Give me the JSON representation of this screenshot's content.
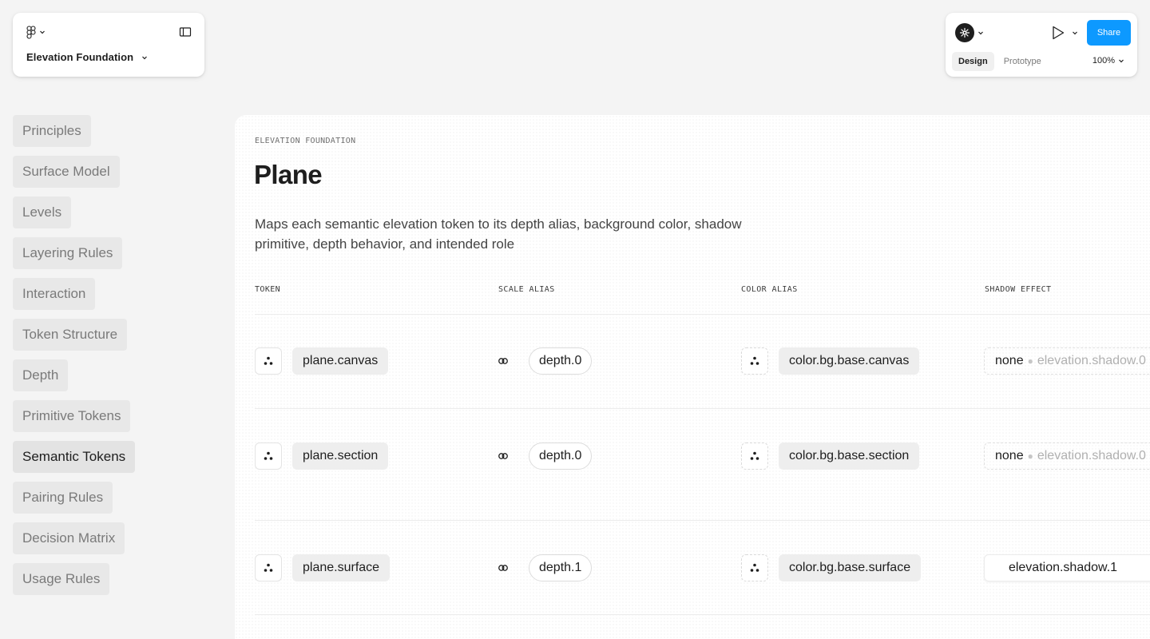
{
  "file": {
    "title": "Elevation Foundation"
  },
  "toolbar": {
    "share_label": "Share",
    "tabs": [
      {
        "label": "Design",
        "active": true
      },
      {
        "label": "Prototype",
        "active": false
      }
    ],
    "zoom": "100%"
  },
  "nav": {
    "items": [
      {
        "label": "Principles",
        "active": false
      },
      {
        "label": "Surface Model",
        "active": false
      },
      {
        "label": "Levels",
        "active": false
      },
      {
        "label": "Layering Rules",
        "active": false
      },
      {
        "label": "Interaction",
        "active": false
      },
      {
        "label": "Token Structure",
        "active": false
      },
      {
        "label": "Depth",
        "active": false
      },
      {
        "label": "Primitive Tokens",
        "active": false
      },
      {
        "label": "Semantic Tokens",
        "active": true
      },
      {
        "label": "Pairing Rules",
        "active": false
      },
      {
        "label": "Decision Matrix",
        "active": false
      },
      {
        "label": "Usage Rules",
        "active": false
      }
    ]
  },
  "main": {
    "eyebrow": "ELEVATION FOUNDATION",
    "title": "Plane",
    "description": "Maps each semantic elevation token to its depth alias, background color, shadow primitive, depth behavior, and intended role",
    "columns": {
      "token": "TOKEN",
      "scale_alias": "SCALE ALIAS",
      "color_alias": "COLOR ALIAS",
      "shadow_effect": "SHADOW EFFECT"
    },
    "rows": [
      {
        "token": "plane.canvas",
        "scale": "depth.0",
        "color": "color.bg.base.canvas",
        "shadow_primary": "none",
        "shadow_secondary": "elevation.shadow.0"
      },
      {
        "token": "plane.section",
        "scale": "depth.0",
        "color": "color.bg.base.section",
        "shadow_primary": "none",
        "shadow_secondary": "elevation.shadow.0"
      },
      {
        "token": "plane.surface",
        "scale": "depth.1",
        "color": "color.bg.base.surface",
        "shadow_primary": "elevation.shadow.1",
        "shadow_secondary": ""
      }
    ]
  },
  "colors": {
    "accent": "#0d99ff",
    "page_bg": "#f4f4f4",
    "panel_bg": "#ffffff",
    "chip_bg": "#eeeeee",
    "nav_bg": "#e8e8e8",
    "muted_text": "#7a7a7a"
  },
  "icons": {
    "app_menu": "figma-logo-icon",
    "panel_toggle": "sidebar-panel-icon",
    "avatar": "snowflake-avatar-icon",
    "present": "play-icon",
    "token": "three-dots-cluster-icon",
    "alias": "link-icon"
  }
}
